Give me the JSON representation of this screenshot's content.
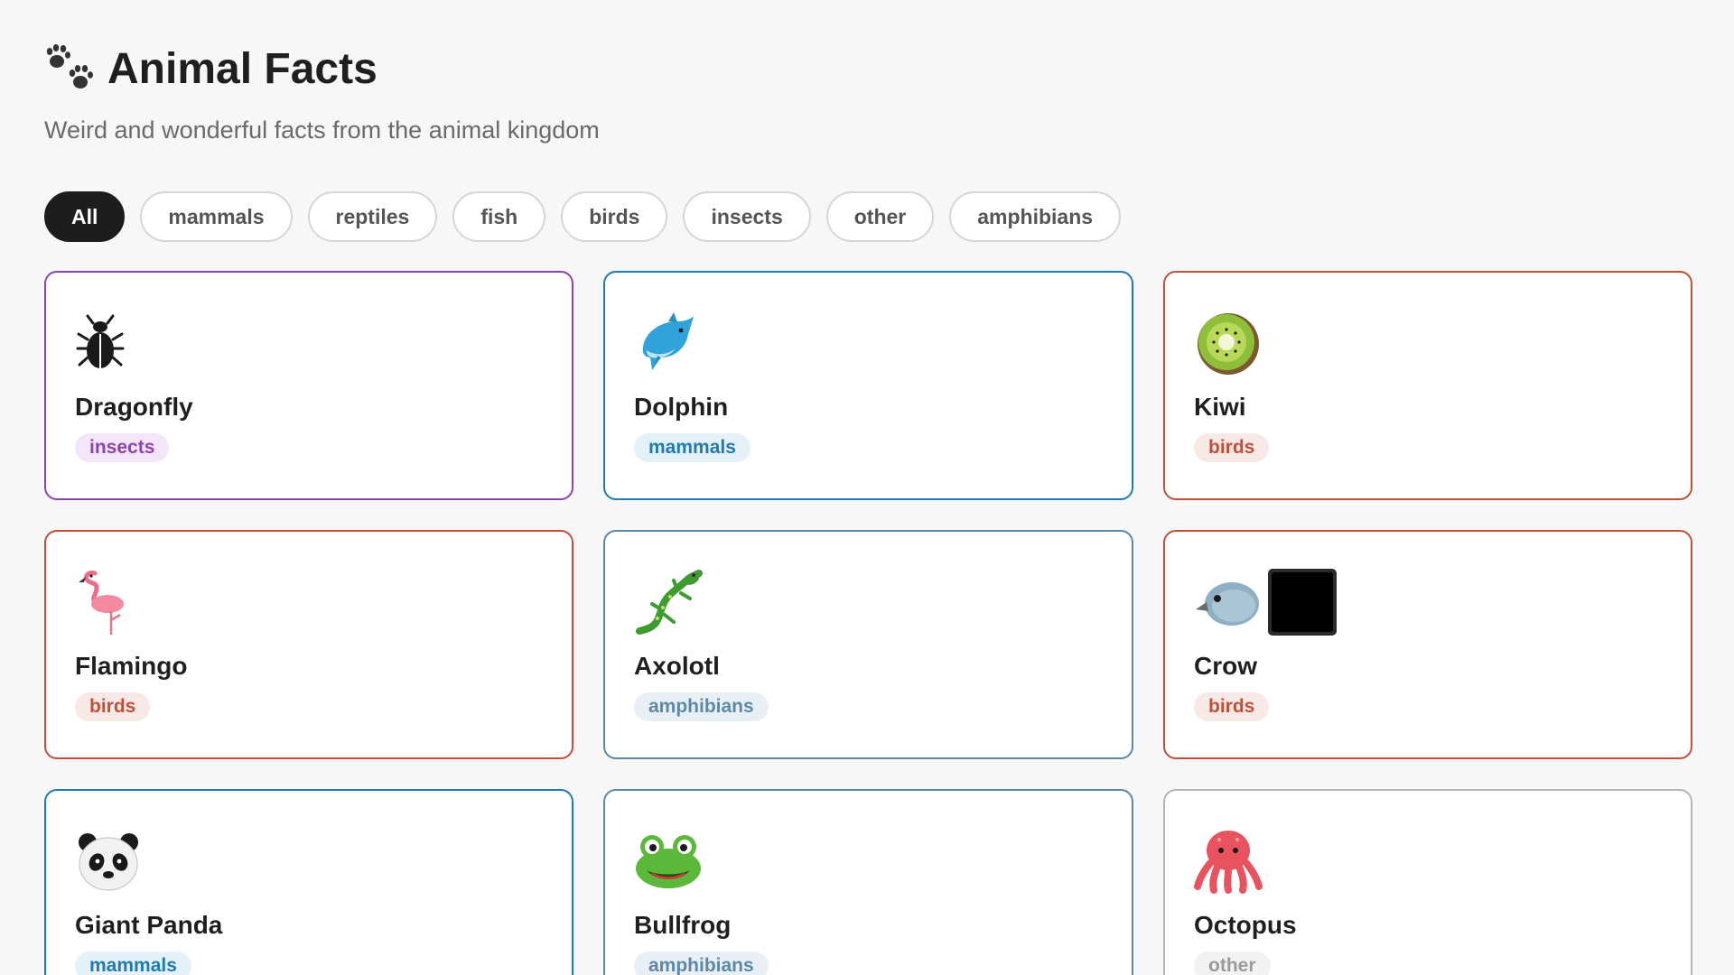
{
  "header": {
    "icon": "paw-prints-icon",
    "title": "Animal Facts",
    "subtitle": "Weird and wonderful facts from the animal kingdom"
  },
  "filters": [
    {
      "label": "All",
      "active": true
    },
    {
      "label": "mammals",
      "active": false
    },
    {
      "label": "reptiles",
      "active": false
    },
    {
      "label": "fish",
      "active": false
    },
    {
      "label": "birds",
      "active": false
    },
    {
      "label": "insects",
      "active": false
    },
    {
      "label": "other",
      "active": false
    },
    {
      "label": "amphibians",
      "active": false
    }
  ],
  "cards": [
    {
      "name": "Dragonfly",
      "category": "insects",
      "icon": "beetle-icon"
    },
    {
      "name": "Dolphin",
      "category": "mammals",
      "icon": "dolphin-icon"
    },
    {
      "name": "Kiwi",
      "category": "birds",
      "icon": "kiwi-fruit-icon"
    },
    {
      "name": "Flamingo",
      "category": "birds",
      "icon": "flamingo-icon"
    },
    {
      "name": "Axolotl",
      "category": "amphibians",
      "icon": "lizard-icon"
    },
    {
      "name": "Crow",
      "category": "birds",
      "icon": "bird-black-square-icon"
    },
    {
      "name": "Giant Panda",
      "category": "mammals",
      "icon": "panda-icon"
    },
    {
      "name": "Bullfrog",
      "category": "amphibians",
      "icon": "frog-icon"
    },
    {
      "name": "Octopus",
      "category": "other",
      "icon": "octopus-icon"
    }
  ],
  "colors": {
    "insects": "#8e44ad",
    "mammals": "#1f7bb0",
    "birds": "#c0503a",
    "amphibians": "#5d88a8",
    "other": "#b5b5b5",
    "active_chip": "#1d1d1d"
  }
}
